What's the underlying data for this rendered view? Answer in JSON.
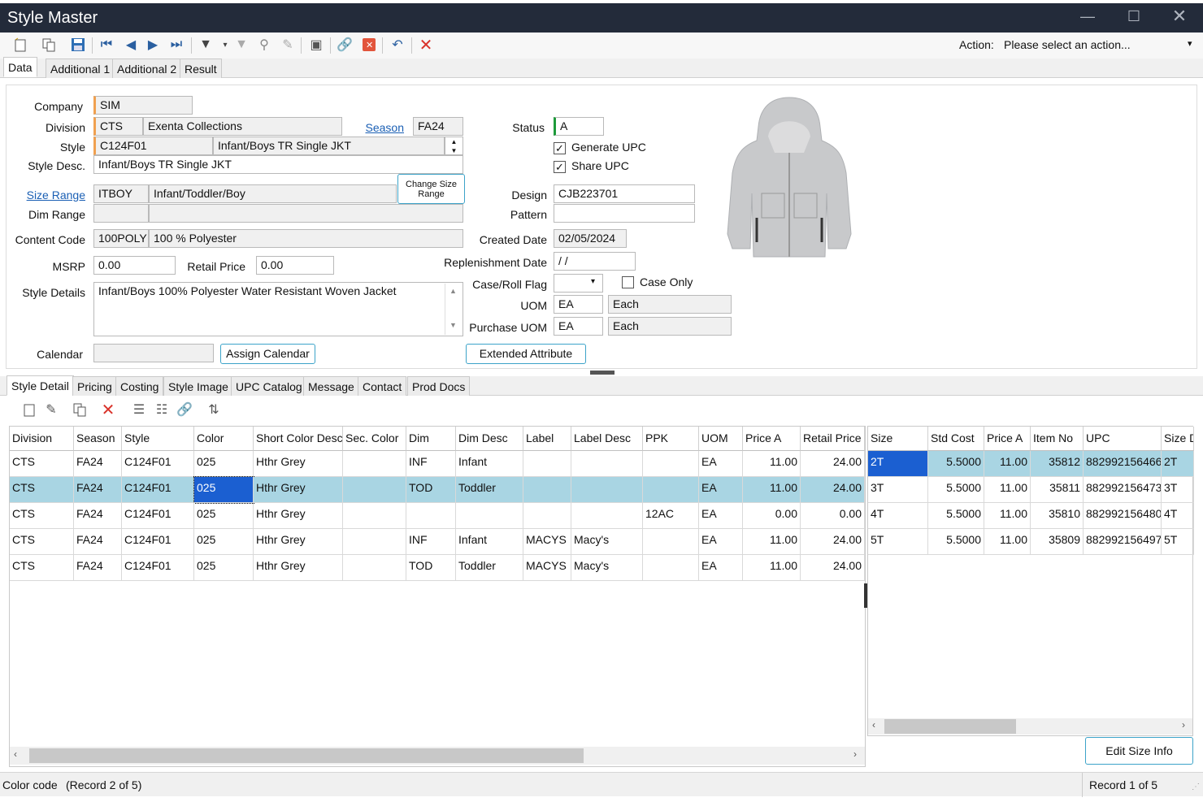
{
  "window": {
    "title": "Style Master"
  },
  "action": {
    "label": "Action:",
    "value": "Please select an action..."
  },
  "top_tabs": [
    "Data",
    "Additional 1",
    "Additional 2",
    "Result"
  ],
  "form": {
    "company_label": "Company",
    "company": "SIM",
    "division_label": "Division",
    "division_code": "CTS",
    "division_name": "Exenta Collections",
    "season_label": "Season",
    "season": "FA24",
    "style_label": "Style",
    "style_code": "C124F01",
    "style_name": "Infant/Boys TR Single JKT",
    "style_desc_label": "Style Desc.",
    "style_desc": "Infant/Boys TR Single JKT",
    "size_range_label": "Size Range",
    "size_range_code": "ITBOY",
    "size_range_name": "Infant/Toddler/Boy",
    "change_size_range": "Change Size Range",
    "dim_range_label": "Dim Range",
    "content_code_label": "Content Code",
    "content_code": "100POLY",
    "content_desc": "100 % Polyester",
    "msrp_label": "MSRP",
    "msrp": "0.00",
    "retail_price_label": "Retail Price",
    "retail_price": "0.00",
    "style_details_label": "Style Details",
    "style_details": "Infant/Boys 100% Polyester Water Resistant Woven Jacket",
    "calendar_label": "Calendar",
    "assign_calendar": "Assign Calendar",
    "status_label": "Status",
    "status": "A",
    "generate_upc": "Generate UPC",
    "share_upc": "Share UPC",
    "design_label": "Design",
    "design": "CJB223701",
    "pattern_label": "Pattern",
    "created_date_label": "Created Date",
    "created_date": "02/05/2024",
    "replenishment_date_label": "Replenishment Date",
    "replenishment_date": " / /",
    "case_roll_label": "Case/Roll Flag",
    "case_only": "Case Only",
    "uom_label": "UOM",
    "uom": "EA",
    "uom_desc": "Each",
    "purchase_uom_label": "Purchase UOM",
    "purchase_uom": "EA",
    "purchase_uom_desc": "Each",
    "extended_attribute": "Extended Attribute"
  },
  "bottom_tabs": [
    "Style Detail",
    "Pricing",
    "Costing",
    "Style Image",
    "UPC Catalog",
    "Message",
    "Contact",
    "Prod Docs"
  ],
  "detail_grid": {
    "columns": [
      "Division",
      "Season",
      "Style",
      "Color",
      "Short Color Desc",
      "Sec. Color",
      "Dim",
      "Dim Desc",
      "Label",
      "Label Desc",
      "PPK",
      "UOM",
      "Price A",
      "Retail Price"
    ],
    "rows": [
      [
        "CTS",
        "FA24",
        "C124F01",
        "025",
        "Hthr Grey",
        "",
        "INF",
        "Infant",
        "",
        "",
        "",
        "EA",
        "11.00",
        "24.00"
      ],
      [
        "CTS",
        "FA24",
        "C124F01",
        "025",
        "Hthr Grey",
        "",
        "TOD",
        "Toddler",
        "",
        "",
        "",
        "EA",
        "11.00",
        "24.00"
      ],
      [
        "CTS",
        "FA24",
        "C124F01",
        "025",
        "Hthr Grey",
        "",
        "",
        "",
        "",
        "",
        "12AC",
        "EA",
        "0.00",
        "0.00"
      ],
      [
        "CTS",
        "FA24",
        "C124F01",
        "025",
        "Hthr Grey",
        "",
        "INF",
        "Infant",
        "MACYS",
        "Macy's",
        "",
        "EA",
        "11.00",
        "24.00"
      ],
      [
        "CTS",
        "FA24",
        "C124F01",
        "025",
        "Hthr Grey",
        "",
        "TOD",
        "Toddler",
        "MACYS",
        "Macy's",
        "",
        "EA",
        "11.00",
        "24.00"
      ]
    ]
  },
  "size_grid": {
    "columns": [
      "Size",
      "Std Cost",
      "Price A",
      "Item No",
      "UPC",
      "Size D"
    ],
    "rows": [
      [
        "2T",
        "5.5000",
        "11.00",
        "35812",
        "882992156466",
        "2T"
      ],
      [
        "3T",
        "5.5000",
        "11.00",
        "35811",
        "882992156473",
        "3T"
      ],
      [
        "4T",
        "5.5000",
        "11.00",
        "35810",
        "882992156480",
        "4T"
      ],
      [
        "5T",
        "5.5000",
        "11.00",
        "35809",
        "882992156497",
        "5T"
      ]
    ]
  },
  "edit_size_info": "Edit Size Info",
  "status_bar": {
    "left": "Color code",
    "record_left": "(Record 2 of 5)",
    "record_right": "Record 1 of 5"
  }
}
